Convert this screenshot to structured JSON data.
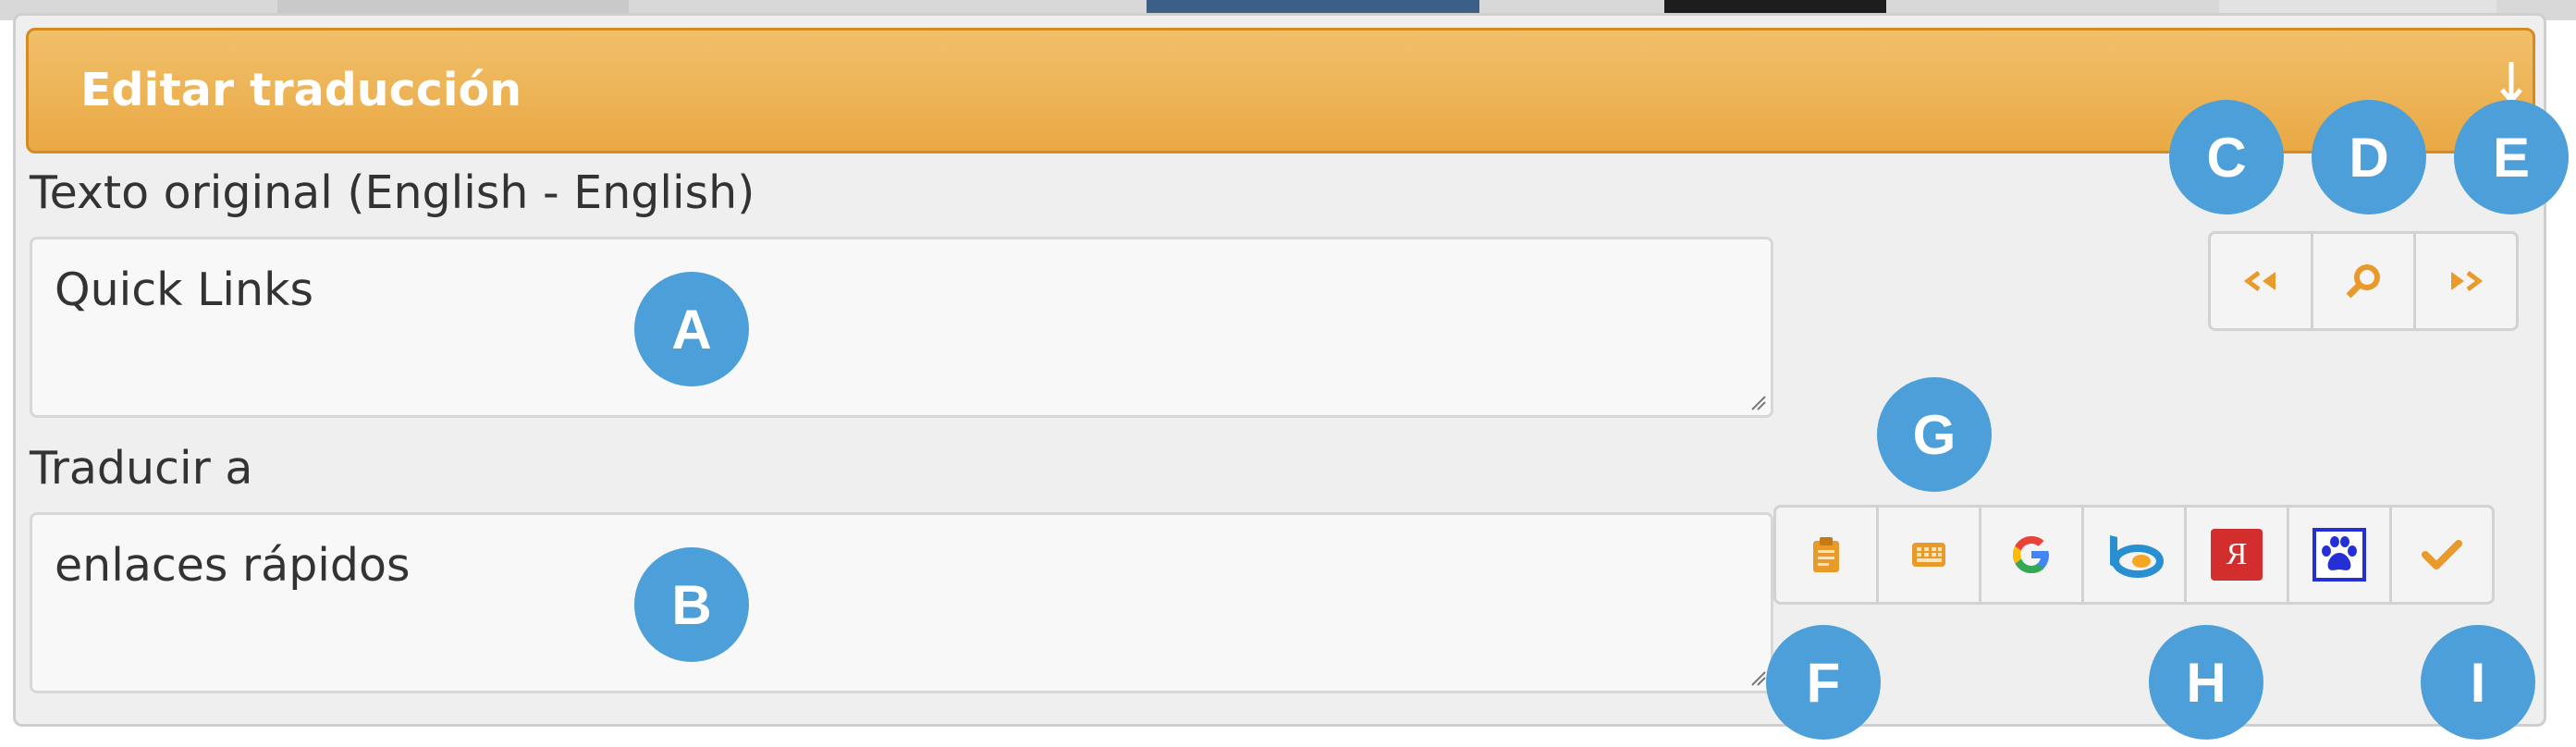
{
  "dialog": {
    "title": "Editar traducción"
  },
  "original": {
    "label": "Texto original (English - English)",
    "value": "Quick Links"
  },
  "translate": {
    "label": "Traducir a",
    "value": "enlaces rápidos"
  },
  "nav_buttons": [
    {
      "icon": "previous-icon"
    },
    {
      "icon": "search-icon"
    },
    {
      "icon": "next-icon"
    }
  ],
  "tool_buttons": [
    {
      "icon": "clipboard-icon"
    },
    {
      "icon": "keyboard-icon"
    },
    {
      "icon": "google-icon"
    },
    {
      "icon": "bing-icon"
    },
    {
      "icon": "yandex-icon",
      "glyph": "Я"
    },
    {
      "icon": "baidu-icon"
    },
    {
      "icon": "checkmark-icon"
    }
  ],
  "callouts": {
    "a": "A",
    "b": "B",
    "c": "C",
    "d": "D",
    "e": "E",
    "f": "F",
    "g": "G",
    "h": "H",
    "i": "I"
  },
  "colors": {
    "titlebar": "#eaa944",
    "callout": "#4d9fd9",
    "icon_orange": "#e89a2a"
  }
}
